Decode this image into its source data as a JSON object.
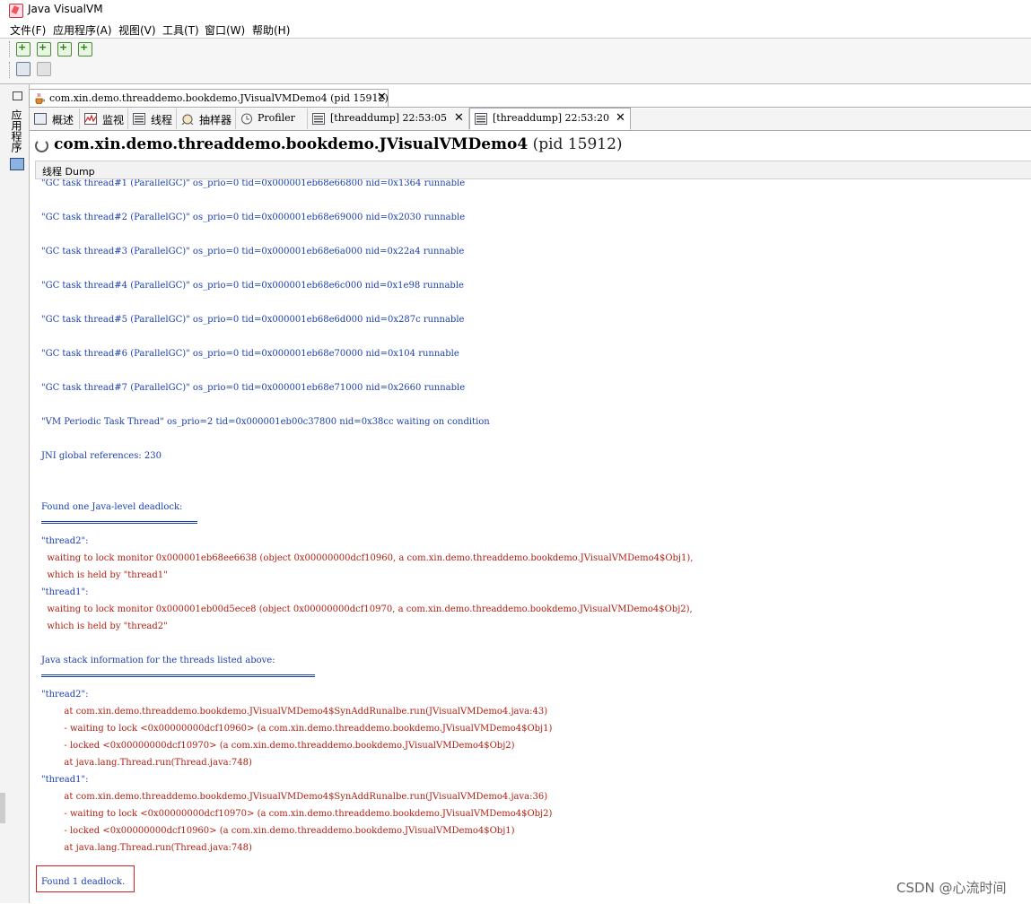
{
  "window": {
    "title": "Java VisualVM"
  },
  "menu": [
    "文件(F)",
    "应用程序(A)",
    "视图(V)",
    "工具(T)",
    "窗口(W)",
    "帮助(H)"
  ],
  "toolbar": {
    "row1": [
      "add-jdbc-connection-icon",
      "add-jmx-connection-icon",
      "add-remote-host-icon",
      "add-vm-coredump-icon"
    ],
    "row2": [
      "load-snapshot-icon",
      "save-snapshot-icon"
    ]
  },
  "left_panel": {
    "label": "应用程序"
  },
  "document_tab": {
    "label": "com.xin.demo.threaddemo.bookdemo.JVisualVMDemo4 (pid 15912)",
    "close": "✕"
  },
  "sub_tabs": [
    {
      "label": "概述"
    },
    {
      "label": "监视"
    },
    {
      "label": "线程"
    },
    {
      "label": "抽样器"
    },
    {
      "label": "Profiler"
    },
    {
      "label": "[threaddump] 22:53:05",
      "close": "✕"
    },
    {
      "label": "[threaddump] 22:53:20",
      "close": "✕"
    }
  ],
  "heading": {
    "app": "com.xin.demo.threaddemo.bookdemo.JVisualVMDemo4",
    "pid": "(pid 15912)"
  },
  "section": {
    "label": "线程 Dump"
  },
  "dump": {
    "gc_lines": [
      "\"GC task thread#1 (ParallelGC)\" os_prio=0 tid=0x000001eb68e66800 nid=0x1364 runnable",
      "\"GC task thread#2 (ParallelGC)\" os_prio=0 tid=0x000001eb68e69000 nid=0x2030 runnable",
      "\"GC task thread#3 (ParallelGC)\" os_prio=0 tid=0x000001eb68e6a000 nid=0x22a4 runnable",
      "\"GC task thread#4 (ParallelGC)\" os_prio=0 tid=0x000001eb68e6c000 nid=0x1e98 runnable",
      "\"GC task thread#5 (ParallelGC)\" os_prio=0 tid=0x000001eb68e6d000 nid=0x287c runnable",
      "\"GC task thread#6 (ParallelGC)\" os_prio=0 tid=0x000001eb68e70000 nid=0x104 runnable",
      "\"GC task thread#7 (ParallelGC)\" os_prio=0 tid=0x000001eb68e71000 nid=0x2660 runnable"
    ],
    "vm_periodic": "\"VM Periodic Task Thread\" os_prio=2 tid=0x000001eb00c37800 nid=0x38cc waiting on condition",
    "jni": "JNI global references: 230",
    "deadlock_header": "Found one Java-level deadlock:",
    "deadlock_lines": [
      "\"thread2\":",
      "  waiting to lock monitor 0x000001eb68ee6638 (object 0x00000000dcf10960, a com.xin.demo.threaddemo.bookdemo.JVisualVMDemo4$Obj1),",
      "  which is held by \"thread1\"",
      "\"thread1\":",
      "  waiting to lock monitor 0x000001eb00d5ece8 (object 0x00000000dcf10970, a com.xin.demo.threaddemo.bookdemo.JVisualVMDemo4$Obj2),",
      "  which is held by \"thread2\""
    ],
    "stack_header": "Java stack information for the threads listed above:",
    "stack_lines": [
      "\"thread2\":",
      "        at com.xin.demo.threaddemo.bookdemo.JVisualVMDemo4$SynAddRunalbe.run(JVisualVMDemo4.java:43)",
      "        - waiting to lock <0x00000000dcf10960> (a com.xin.demo.threaddemo.bookdemo.JVisualVMDemo4$Obj1)",
      "        - locked <0x00000000dcf10970> (a com.xin.demo.threaddemo.bookdemo.JVisualVMDemo4$Obj2)",
      "        at java.lang.Thread.run(Thread.java:748)",
      "\"thread1\":",
      "        at com.xin.demo.threaddemo.bookdemo.JVisualVMDemo4$SynAddRunalbe.run(JVisualVMDemo4.java:36)",
      "        - waiting to lock <0x00000000dcf10970> (a com.xin.demo.threaddemo.bookdemo.JVisualVMDemo4$Obj2)",
      "        - locked <0x00000000dcf10960> (a com.xin.demo.threaddemo.bookdemo.JVisualVMDemo4$Obj1)",
      "        at java.lang.Thread.run(Thread.java:748)"
    ],
    "footer": "Found 1 deadlock."
  },
  "watermark": "CSDN @心流时间",
  "colors": {
    "dump_blue": "#1a3fb0",
    "dump_red": "#b01e12",
    "highlight_box": "#d02020"
  }
}
